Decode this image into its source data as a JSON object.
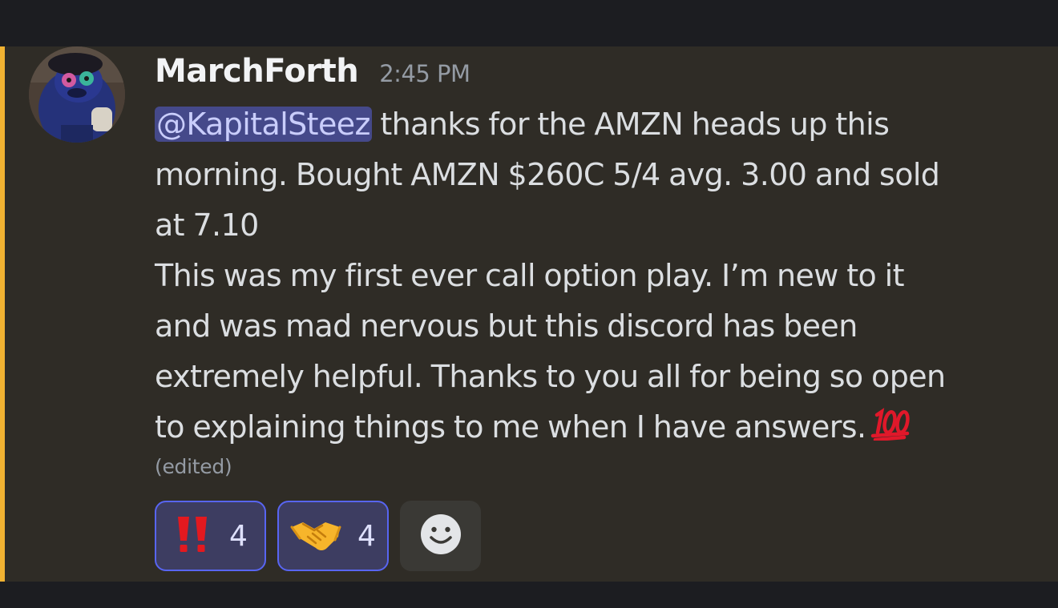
{
  "message": {
    "author": "MarchForth",
    "timestamp": "2:45 PM",
    "mention": "@KapitalSteez",
    "lines": [
      " thanks for the AMZN heads up this",
      "morning. Bought AMZN $260C 5/4 avg. 3.00 and sold",
      "at 7.10",
      "This was my first ever call option play. I’m new to it",
      "and was mad nervous but this discord has been",
      "extremely helpful. Thanks to you all for being so open",
      "to explaining things to me when I have answers."
    ],
    "trailing_emoji": "hundred-points-emoji",
    "edited_label": "(edited)"
  },
  "reactions": [
    {
      "emoji": "double-exclamation-emoji",
      "count": "4",
      "active": true
    },
    {
      "emoji": "handshake-emoji",
      "count": "4",
      "active": true
    }
  ],
  "add_reaction_icon": "smiley-add-reaction-icon",
  "colors": {
    "highlight_bar": "#f0b232",
    "mention_bg": "#45498a",
    "mention_text": "#c9cdfb",
    "reaction_border": "#5865f2",
    "message_bg": "#2f2c26",
    "page_bg": "#1c1d21"
  }
}
